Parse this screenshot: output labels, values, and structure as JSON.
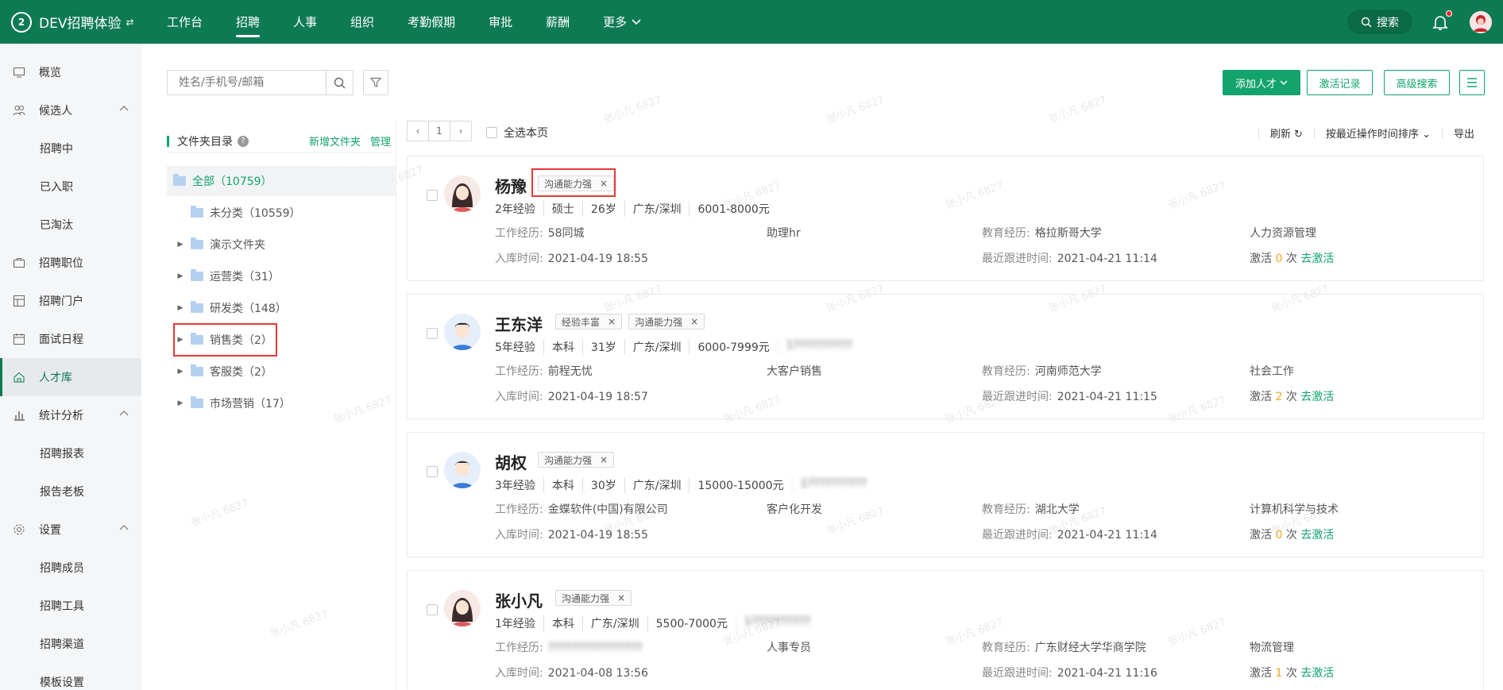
{
  "app": {
    "title": "DEV招聘体验"
  },
  "nav": {
    "items": [
      "工作台",
      "招聘",
      "人事",
      "组织",
      "考勤假期",
      "审批",
      "薪酬"
    ],
    "more": "更多",
    "active": 1
  },
  "topbar": {
    "search": "搜索"
  },
  "sidebar": {
    "overview": "概览",
    "candidates": "候选人",
    "candidates_sub": [
      "招聘中",
      "已入职",
      "已淘汰"
    ],
    "positions": "招聘职位",
    "portal": "招聘门户",
    "schedule": "面试日程",
    "talent": "人才库",
    "stats": "统计分析",
    "stats_sub": [
      "招聘报表",
      "报告老板"
    ],
    "settings": "设置",
    "settings_sub": [
      "招聘成员",
      "招聘工具",
      "招聘渠道",
      "模板设置"
    ]
  },
  "toolbar": {
    "search_placeholder": "姓名/手机号/邮箱",
    "add_talent": "添加人才",
    "activation_log": "激活记录",
    "advanced_search": "高级搜索"
  },
  "folders": {
    "title": "文件夹目录",
    "new_folder": "新增文件夹",
    "manage": "管理",
    "items": [
      {
        "label": "全部（10759）"
      },
      {
        "label": "未分类（10559）"
      },
      {
        "label": "演示文件夹"
      },
      {
        "label": "运营类（31）"
      },
      {
        "label": "研发类（148）"
      },
      {
        "label": "销售类（2）"
      },
      {
        "label": "客服类（2）"
      },
      {
        "label": "市场营销（17）"
      }
    ]
  },
  "list": {
    "page": "1",
    "select_all": "全选本页",
    "refresh": "刷新",
    "sort": "按最近操作时间排序",
    "export": "导出"
  },
  "labels": {
    "work": "工作经历:",
    "edu": "教育经历:",
    "added": "入库时间:",
    "followup": "最近跟进时间:",
    "activate": "激活",
    "times": "次",
    "go_activate": "去激活"
  },
  "candidates": [
    {
      "name": "杨豫",
      "tags": [
        "沟通能力强"
      ],
      "meta": [
        "2年经验",
        "硕士",
        "26岁",
        "广东/深圳",
        "6001-8000元"
      ],
      "company": "58同城",
      "position": "助理hr",
      "school": "格拉斯哥大学",
      "major": "人力资源管理",
      "added": "2021-04-19 18:55",
      "followup": "2021-04-21 11:14",
      "count": "0"
    },
    {
      "name": "王东洋",
      "tags": [
        "经验丰富",
        "沟通能力强"
      ],
      "meta": [
        "5年经验",
        "本科",
        "31岁",
        "广东/深圳",
        "6000-7999元"
      ],
      "phone": "1??????????",
      "company": "前程无忧",
      "position": "大客户销售",
      "school": "河南师范大学",
      "major": "社会工作",
      "added": "2021-04-19 18:57",
      "followup": "2021-04-21 11:15",
      "count": "2"
    },
    {
      "name": "胡权",
      "tags": [
        "沟通能力强"
      ],
      "meta": [
        "3年经验",
        "本科",
        "30岁",
        "广东/深圳",
        "15000-15000元"
      ],
      "phone": "1??????????",
      "company": "金蝶软件(中国)有限公司",
      "position": "客户化开发",
      "school": "湖北大学",
      "major": "计算机科学与技术",
      "added": "2021-04-19 18:55",
      "followup": "2021-04-21 11:14",
      "count": "0"
    },
    {
      "name": "张小凡",
      "tags": [
        "沟通能力强"
      ],
      "meta": [
        "1年经验",
        "本科",
        "广东/深圳",
        "5500-7000元"
      ],
      "phone": "1??????????",
      "company": "????????????????",
      "position": "人事专员",
      "school": "广东财经大学华商学院",
      "major": "物流管理",
      "added": "2021-04-08 13:56",
      "followup": "2021-04-21 11:16",
      "count": "1"
    }
  ],
  "watermark": "张小凡 6827",
  "colors": {
    "brand": "#0d7a53",
    "accent": "#13a36d",
    "highlight": "#e53935"
  }
}
